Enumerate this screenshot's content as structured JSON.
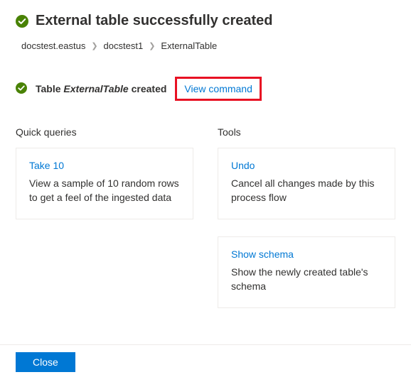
{
  "header": {
    "title": "External table successfully created"
  },
  "breadcrumb": {
    "items": [
      "docstest.eastus",
      "docstest1",
      "ExternalTable"
    ]
  },
  "status": {
    "prefix": "Table ",
    "table_name": "ExternalTable",
    "suffix": " created",
    "view_command_label": "View command"
  },
  "quick_queries": {
    "section_title": "Quick queries",
    "cards": [
      {
        "title": "Take 10",
        "desc": "View a sample of 10 random rows to get a feel of the ingested data"
      }
    ]
  },
  "tools": {
    "section_title": "Tools",
    "cards": [
      {
        "title": "Undo",
        "desc": "Cancel all changes made by this process flow"
      },
      {
        "title": "Show schema",
        "desc": "Show the newly created table's schema"
      }
    ]
  },
  "footer": {
    "close_label": "Close"
  },
  "colors": {
    "accent": "#0078d4",
    "success": "#498205",
    "highlight": "#e81123"
  }
}
